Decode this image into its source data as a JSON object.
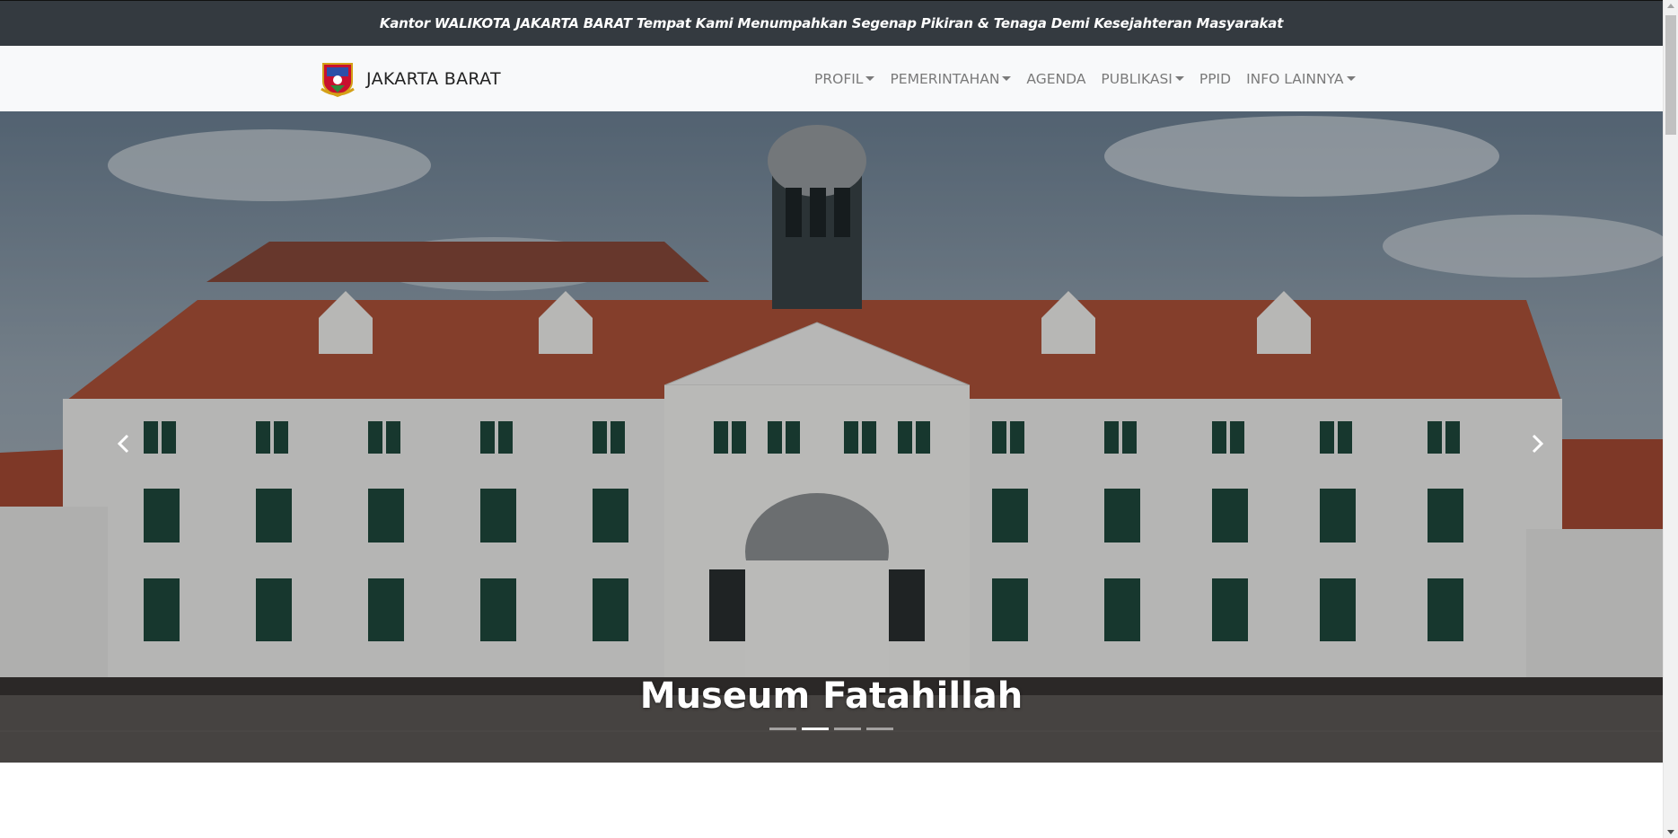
{
  "topbar": {
    "announcement": "Kantor WALIKOTA JAKARTA BARAT Tempat Kami Menumpahkan Segenap Pikiran & Tenaga Demi Kesejahteran Masyarakat"
  },
  "navbar": {
    "brand": "JAKARTA BARAT",
    "logo_icon": "coat-of-arms-icon",
    "items": [
      {
        "label": "PROFIL",
        "dropdown": true
      },
      {
        "label": "PEMERINTAHAN",
        "dropdown": true
      },
      {
        "label": "AGENDA",
        "dropdown": false
      },
      {
        "label": "PUBLIKASI",
        "dropdown": true
      },
      {
        "label": "PPID",
        "dropdown": false
      },
      {
        "label": "INFO LAINNYA",
        "dropdown": true
      }
    ]
  },
  "hero": {
    "caption": "Museum Fatahillah",
    "slide_count": 4,
    "active_slide": 2,
    "prev_icon": "chevron-left-icon",
    "next_icon": "chevron-right-icon"
  },
  "colors": {
    "topbar_bg": "#343a40",
    "navbar_bg": "#f8f9fa",
    "nav_text": "#7a7a7a",
    "roof": "#b0533a",
    "wall": "#f2f2f0",
    "shutter": "#1f4a3e"
  }
}
